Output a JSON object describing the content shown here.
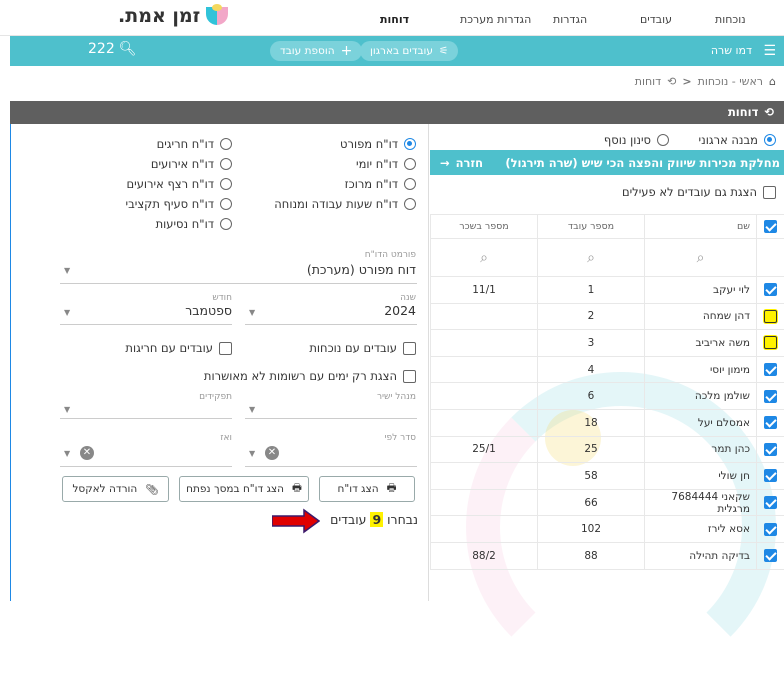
{
  "nav": {
    "items": [
      "נוכחות",
      "עובדים",
      "הגדרות",
      "הגדרות מערכת",
      "דוחות"
    ],
    "logo_text": "זמן אמת."
  },
  "toolbar": {
    "company_label": "דמו שרה",
    "employees_filter": "עובדים בארגון",
    "add_employee": "הוספת עובד",
    "search_count": "222"
  },
  "breadcrumb": {
    "home": "ראשי - נוכחות",
    "current": "דוחות"
  },
  "section_title": "דוחות",
  "right_panel": {
    "filter_options": [
      "מבנה ארגוני",
      "סינון נוסף"
    ],
    "dept_name": "מחלקת מכירות שיווק והפצה הכי שיש (שרה תירגול)",
    "back_label": "חזרה",
    "show_inactive": "הצגת גם עובדים לא פעילים",
    "columns": [
      "שם",
      "מספר עובד",
      "מספר בשכר"
    ],
    "rows": [
      {
        "name": "לוי יעקב",
        "num": "1",
        "pay": "11/1",
        "state": "checked"
      },
      {
        "name": "דהן שמחה",
        "num": "2",
        "pay": "",
        "state": "highlight"
      },
      {
        "name": "משה אריביב",
        "num": "3",
        "pay": "",
        "state": "highlight"
      },
      {
        "name": "מימון יוסי",
        "num": "4",
        "pay": "",
        "state": "checked"
      },
      {
        "name": "שולמן מלכה",
        "num": "6",
        "pay": "",
        "state": "checked"
      },
      {
        "name": "אמסלם יעל",
        "num": "18",
        "pay": "",
        "state": "checked"
      },
      {
        "name": "כהן תמר",
        "num": "25",
        "pay": "25/1",
        "state": "checked"
      },
      {
        "name": "חן שולי",
        "num": "58",
        "pay": "",
        "state": "checked"
      },
      {
        "name": "שקאני 7684444 מרגלית",
        "num": "66",
        "pay": "",
        "state": "checked"
      },
      {
        "name": "אסא לירז",
        "num": "102",
        "pay": "",
        "state": "checked"
      },
      {
        "name": "בדיקה תהילה",
        "num": "88",
        "pay": "88/2",
        "state": "checked"
      }
    ]
  },
  "reports": {
    "col1": [
      "דו\"ח מפורט",
      "דו\"ח יומי",
      "דו\"ח מרוכז",
      "דו\"ח שעות עבודה ומנוחה"
    ],
    "col2": [
      "דו\"ח חריגים",
      "דו\"ח אירועים",
      "דו\"ח רצף אירועים",
      "דו\"ח סעיף תקציבי",
      "דו\"ח נסיעות"
    ]
  },
  "form": {
    "format_label": "פורמט הדו\"ח",
    "format_value": "דוח מפורט (מערכת)",
    "year_label": "שנה",
    "year_value": "2024",
    "month_label": "חודש",
    "month_value": "ספטמבר",
    "with_attendance": "עובדים עם נוכחות",
    "with_exceptions": "עובדים עם חריגות",
    "unapproved_only": "הצגת רק ימים עם רשומות לא מאושרות",
    "manager_label": "מנהל ישיר",
    "roles_label": "תפקידים",
    "sort_label": "סדר לפי",
    "then_label": "ואז"
  },
  "buttons": {
    "show": "הצג דו\"ח",
    "show_new": "הצג דו\"ח במסך נפתח",
    "excel": "הורדה לאקסל"
  },
  "selection": {
    "prefix": "נבחרו",
    "count": "9",
    "suffix": "עובדים"
  },
  "colors": {
    "teal": "#4ec0cc",
    "dark": "#5f5f5f",
    "accent": "#1e88e5",
    "highlight": "#fff200",
    "arrow": "#e00000"
  }
}
